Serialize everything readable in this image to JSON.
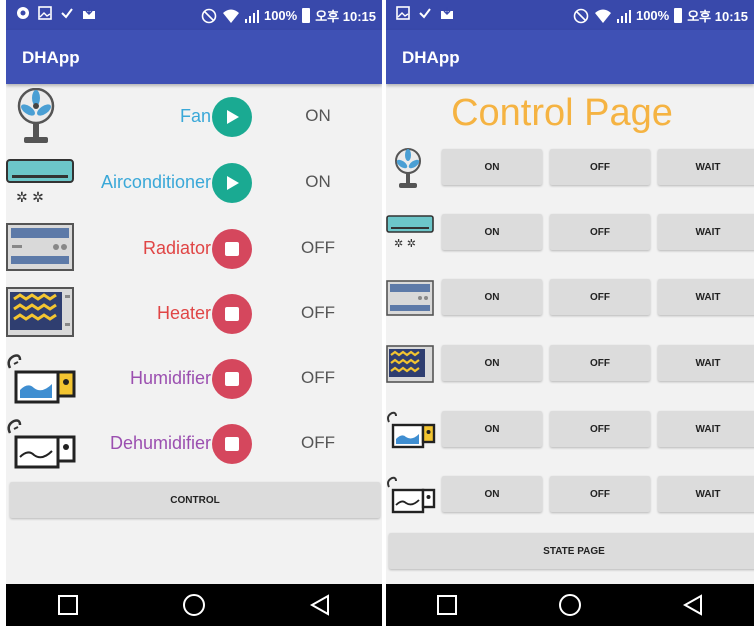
{
  "status_bar": {
    "battery": "100%",
    "time": "오후 10:15"
  },
  "left_screen": {
    "app_title": "DHApp",
    "devices": [
      {
        "name": "Fan",
        "icon": "fan-icon",
        "state": "ON",
        "state_icon": "play-icon",
        "color": "#3aa8d8"
      },
      {
        "name": "Airconditioner",
        "icon": "air-conditioner-icon",
        "state": "ON",
        "state_icon": "play-icon",
        "color": "#3aa8d8"
      },
      {
        "name": "Radiator",
        "icon": "radiator-icon",
        "state": "OFF",
        "state_icon": "stop-icon",
        "color": "#e04545"
      },
      {
        "name": "Heater",
        "icon": "heater-icon",
        "state": "OFF",
        "state_icon": "stop-icon",
        "color": "#e04545"
      },
      {
        "name": "Humidifier",
        "icon": "humidifier-icon",
        "state": "OFF",
        "state_icon": "stop-icon",
        "color": "#9b4fb0"
      },
      {
        "name": "Dehumidifier",
        "icon": "dehumidifier-icon",
        "state": "OFF",
        "state_icon": "stop-icon",
        "color": "#9b4fb0"
      }
    ],
    "control_button": "CONTROL"
  },
  "right_screen": {
    "app_title": "DHApp",
    "page_title": "Control Page",
    "rows": [
      {
        "icon": "fan-icon",
        "on": "ON",
        "off": "OFF",
        "wait": "WAIT"
      },
      {
        "icon": "air-conditioner-icon",
        "on": "ON",
        "off": "OFF",
        "wait": "WAIT"
      },
      {
        "icon": "radiator-icon",
        "on": "ON",
        "off": "OFF",
        "wait": "WAIT"
      },
      {
        "icon": "heater-icon",
        "on": "ON",
        "off": "OFF",
        "wait": "WAIT"
      },
      {
        "icon": "humidifier-icon",
        "on": "ON",
        "off": "OFF",
        "wait": "WAIT"
      },
      {
        "icon": "dehumidifier-icon",
        "on": "ON",
        "off": "OFF",
        "wait": "WAIT"
      }
    ],
    "state_page_button": "STATE PAGE"
  },
  "colors": {
    "status_bar": "#3949ab",
    "app_bar": "#3f51b5",
    "play_green": "#1aaa92",
    "stop_red": "#d5475d",
    "title_orange": "#f5b342"
  }
}
